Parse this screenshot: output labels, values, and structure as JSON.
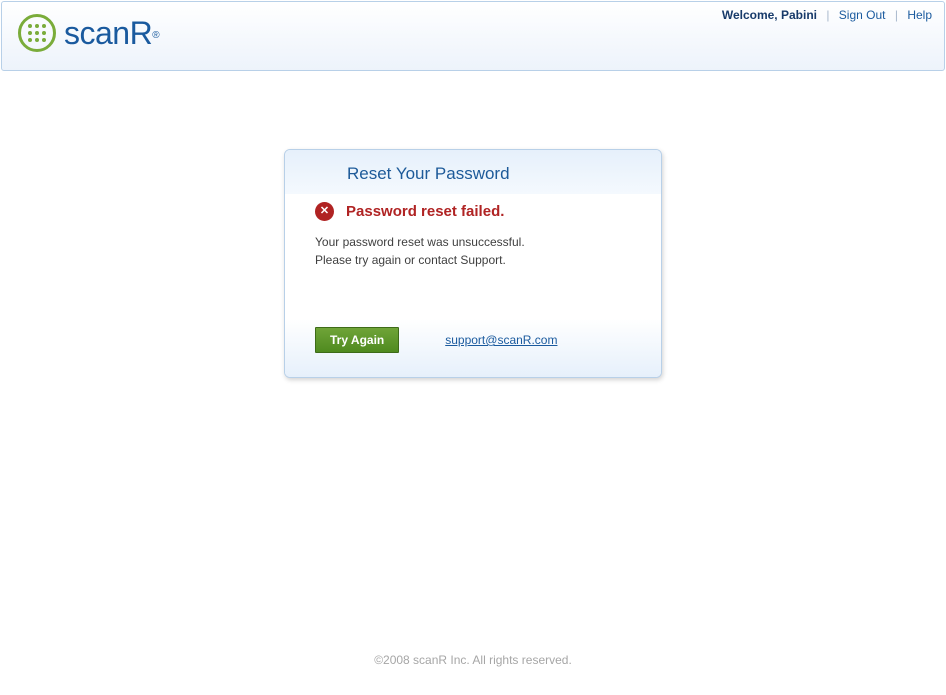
{
  "header": {
    "logo_text": "scanR",
    "welcome": "Welcome, Pabini",
    "sign_out": "Sign Out",
    "help": "Help"
  },
  "card": {
    "title": "Reset Your Password",
    "error_title": "Password reset failed.",
    "error_line1": "Your password reset was unsuccessful.",
    "error_line2": "Please try again or contact Support.",
    "try_again": "Try Again",
    "support_email": "support@scanR.com"
  },
  "footer": {
    "copyright": "©2008 scanR Inc. All rights reserved."
  }
}
